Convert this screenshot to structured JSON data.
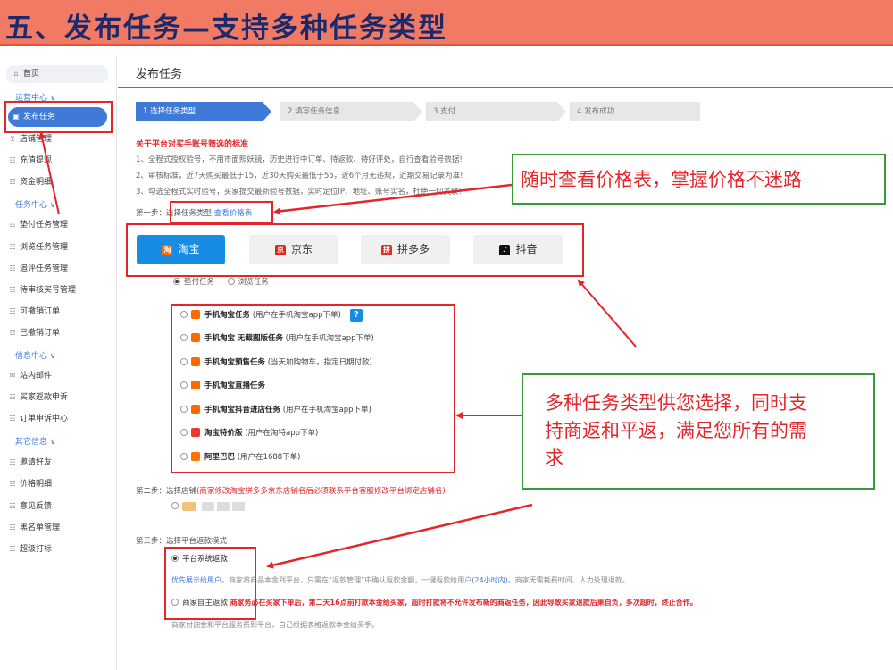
{
  "banner": {
    "title": "五、发布任务—支持多种任务类型"
  },
  "sidebar": {
    "home": "首页",
    "groups": [
      {
        "head": "运营中心 ∨",
        "items": [
          "发布任务",
          "店铺管理",
          "充值提现",
          "资金明细"
        ]
      },
      {
        "head": "任务中心 ∨",
        "items": [
          "垫付任务管理",
          "浏览任务管理",
          "追评任务管理",
          "待审核买号管理",
          "可撤销订单",
          "已撤销订单"
        ]
      },
      {
        "head": "信息中心 ∨",
        "items": [
          "站内邮件",
          "买家返款申诉",
          "订单申诉中心"
        ]
      },
      {
        "head": "其它信息 ∨",
        "items": [
          "邀请好友",
          "价格明细",
          "意见反馈",
          "黑名单管理",
          "超级打标"
        ]
      }
    ]
  },
  "main": {
    "page_title": "发布任务",
    "steps": [
      "1.选择任务类型",
      "2.填写任务信息",
      "3.支付",
      "4.发布成功"
    ],
    "rules_title": "关于平台对买手账号筛选的标准",
    "rules": [
      "1、全程式授权验号，不用市面照妖镜，历史进行中订单、待返款、待好评处，自行查看验号数据!",
      "2、审核标准，近7天购买最低于15，近30天购买最低于55，近6个月无违规，近期交易记录为准!",
      "3、勾选全程式实时验号，买家提交最新验号数据，实时定位IP、地址、账号实名，杜绝一切关联!"
    ],
    "step1_label": "第一步：选择任务类型",
    "price_link": "查看价格表",
    "platforms": [
      {
        "name": "淘宝",
        "icon": "taobao-icon"
      },
      {
        "name": "京东",
        "icon": "jingdong-icon"
      },
      {
        "name": "拼多多",
        "icon": "pinduoduo-icon"
      },
      {
        "name": "抖音",
        "icon": "douyin-icon"
      }
    ],
    "task_modes": [
      "垫付任务",
      "浏览任务"
    ],
    "tasks": [
      {
        "name": "手机淘宝任务",
        "note": "(用户在手机淘宝app下单)"
      },
      {
        "name": "手机淘宝 无截图版任务",
        "note": "(用户在手机淘宝app下单)"
      },
      {
        "name": "手机淘宝预售任务",
        "note": "(当天加购物车，指定日期付款)"
      },
      {
        "name": "手机淘宝直播任务",
        "note": ""
      },
      {
        "name": "手机淘宝抖音进店任务",
        "note": "(用户在手机淘宝app下单)"
      },
      {
        "name": "淘宝特价版",
        "note": "(用户在淘特app下单)"
      },
      {
        "name": "阿里巴巴",
        "note": "(用户在1688下单)"
      }
    ],
    "help_glyph": "?",
    "step2_label": "第二步：选择店铺",
    "step2_note": "(商家修改淘宝拼多多京东店铺名后必须联系平台客服修改平台绑定店铺名)",
    "step3_label": "第三步：选择平台返款模式",
    "refund_platform": "平台系统返款",
    "refund_platform_desc_lead": "优先展示给用户",
    "refund_platform_desc": "。商家将商品本金到平台，只需在“返款管理”中确认返款金额，一键返款给用户",
    "refund_platform_time": "(24小时内)",
    "refund_platform_tail": "。商家无需耗费时间、人力处理退款。",
    "refund_merchant": "商家自主返款",
    "refund_merchant_warn": "商家务必在买家下单后，第二天16点前打款本金给买家，超时打款将不允许发布新的商返任务，因此导致买家退款后果自负，多次超时，终止合作。",
    "refund_merchant_desc": "商家付佣金和平台服务费到平台，自己根据表格返款本金给买手。"
  },
  "callouts": {
    "price": "随时查看价格表，掌握价格不迷路",
    "types_line1": "多种任务类型供您选择，同时支",
    "types_line2": "持商返和平返，满足您所有的需",
    "types_line3": "求"
  },
  "colors": {
    "accent": "#3f7ad8",
    "banner": "#f07a63",
    "annotation_red": "#e3262b",
    "annotation_green": "#3a9a3a",
    "platform_active": "#168de2"
  }
}
